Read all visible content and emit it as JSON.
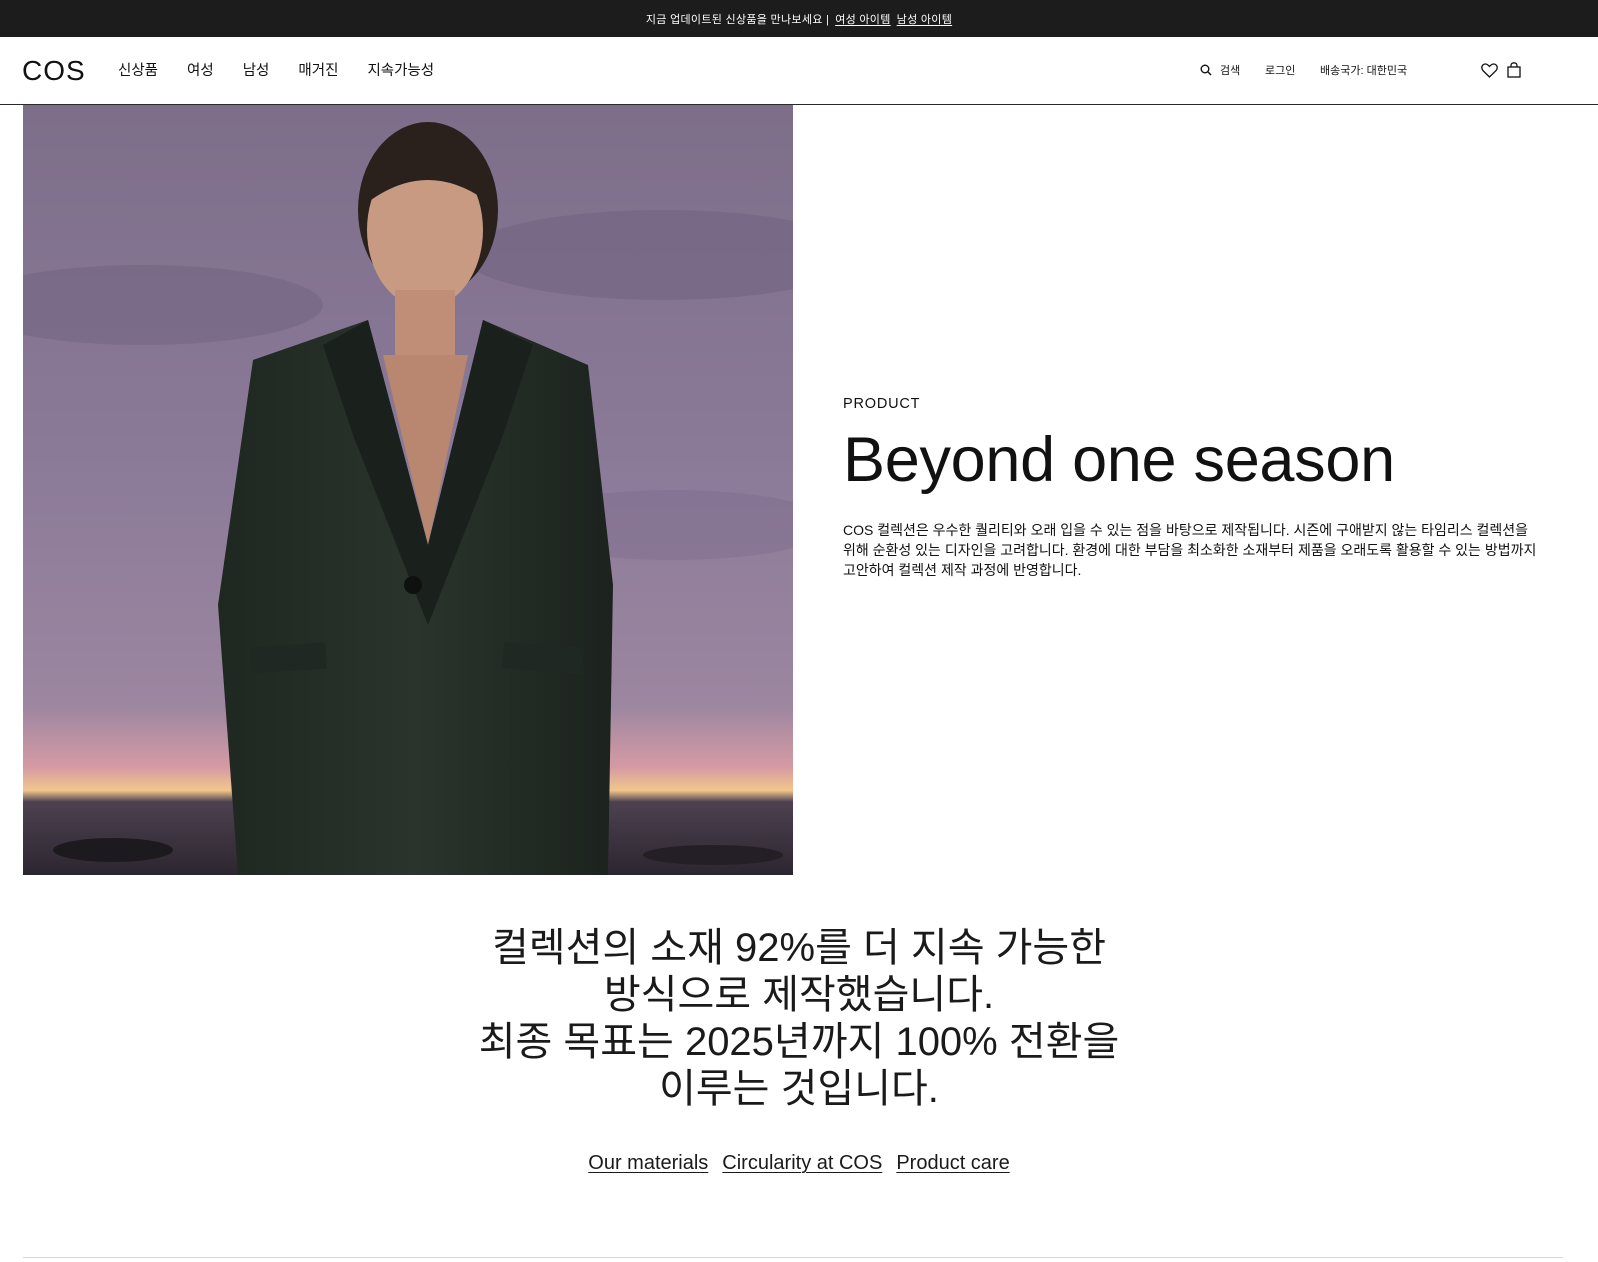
{
  "announcement": {
    "text": "지금 업데이트된 신상품을 만나보세요 |",
    "link_women": "여성 아이템",
    "link_men": "남성 아이템"
  },
  "header": {
    "logo": "COS",
    "nav": [
      "신상품",
      "여성",
      "남성",
      "매거진",
      "지속가능성"
    ],
    "search_label": "검색",
    "login_label": "로그인",
    "country_label": "배송국가: 대한민국"
  },
  "hero": {
    "eyebrow": "PRODUCT",
    "headline": "Beyond one season",
    "body": "COS 컬렉션은 우수한 퀄리티와 오래 입을 수 있는 점을 바탕으로 제작됩니다. 시즌에 구애받지 않는 타임리스 컬렉션을 위해 순환성 있는 디자인을 고려합니다. 환경에 대한 부담을 최소화한 소재부터 제품을 오래도록 활용할 수 있는 방법까지 고안하여 컬렉션 제작 과정에 반영합니다."
  },
  "statement": {
    "lines": [
      "컬렉션의 소재 92%를 더 지속 가능한",
      "방식으로 제작했습니다.",
      "최종 목표는 2025년까지 100% 전환을",
      "이루는 것입니다."
    ]
  },
  "links": [
    "Our materials",
    "Circularity at COS",
    "Product care"
  ],
  "colors": {
    "announcement_bg": "#1c1c1c",
    "text": "#1a1a1a",
    "background": "#ffffff"
  }
}
